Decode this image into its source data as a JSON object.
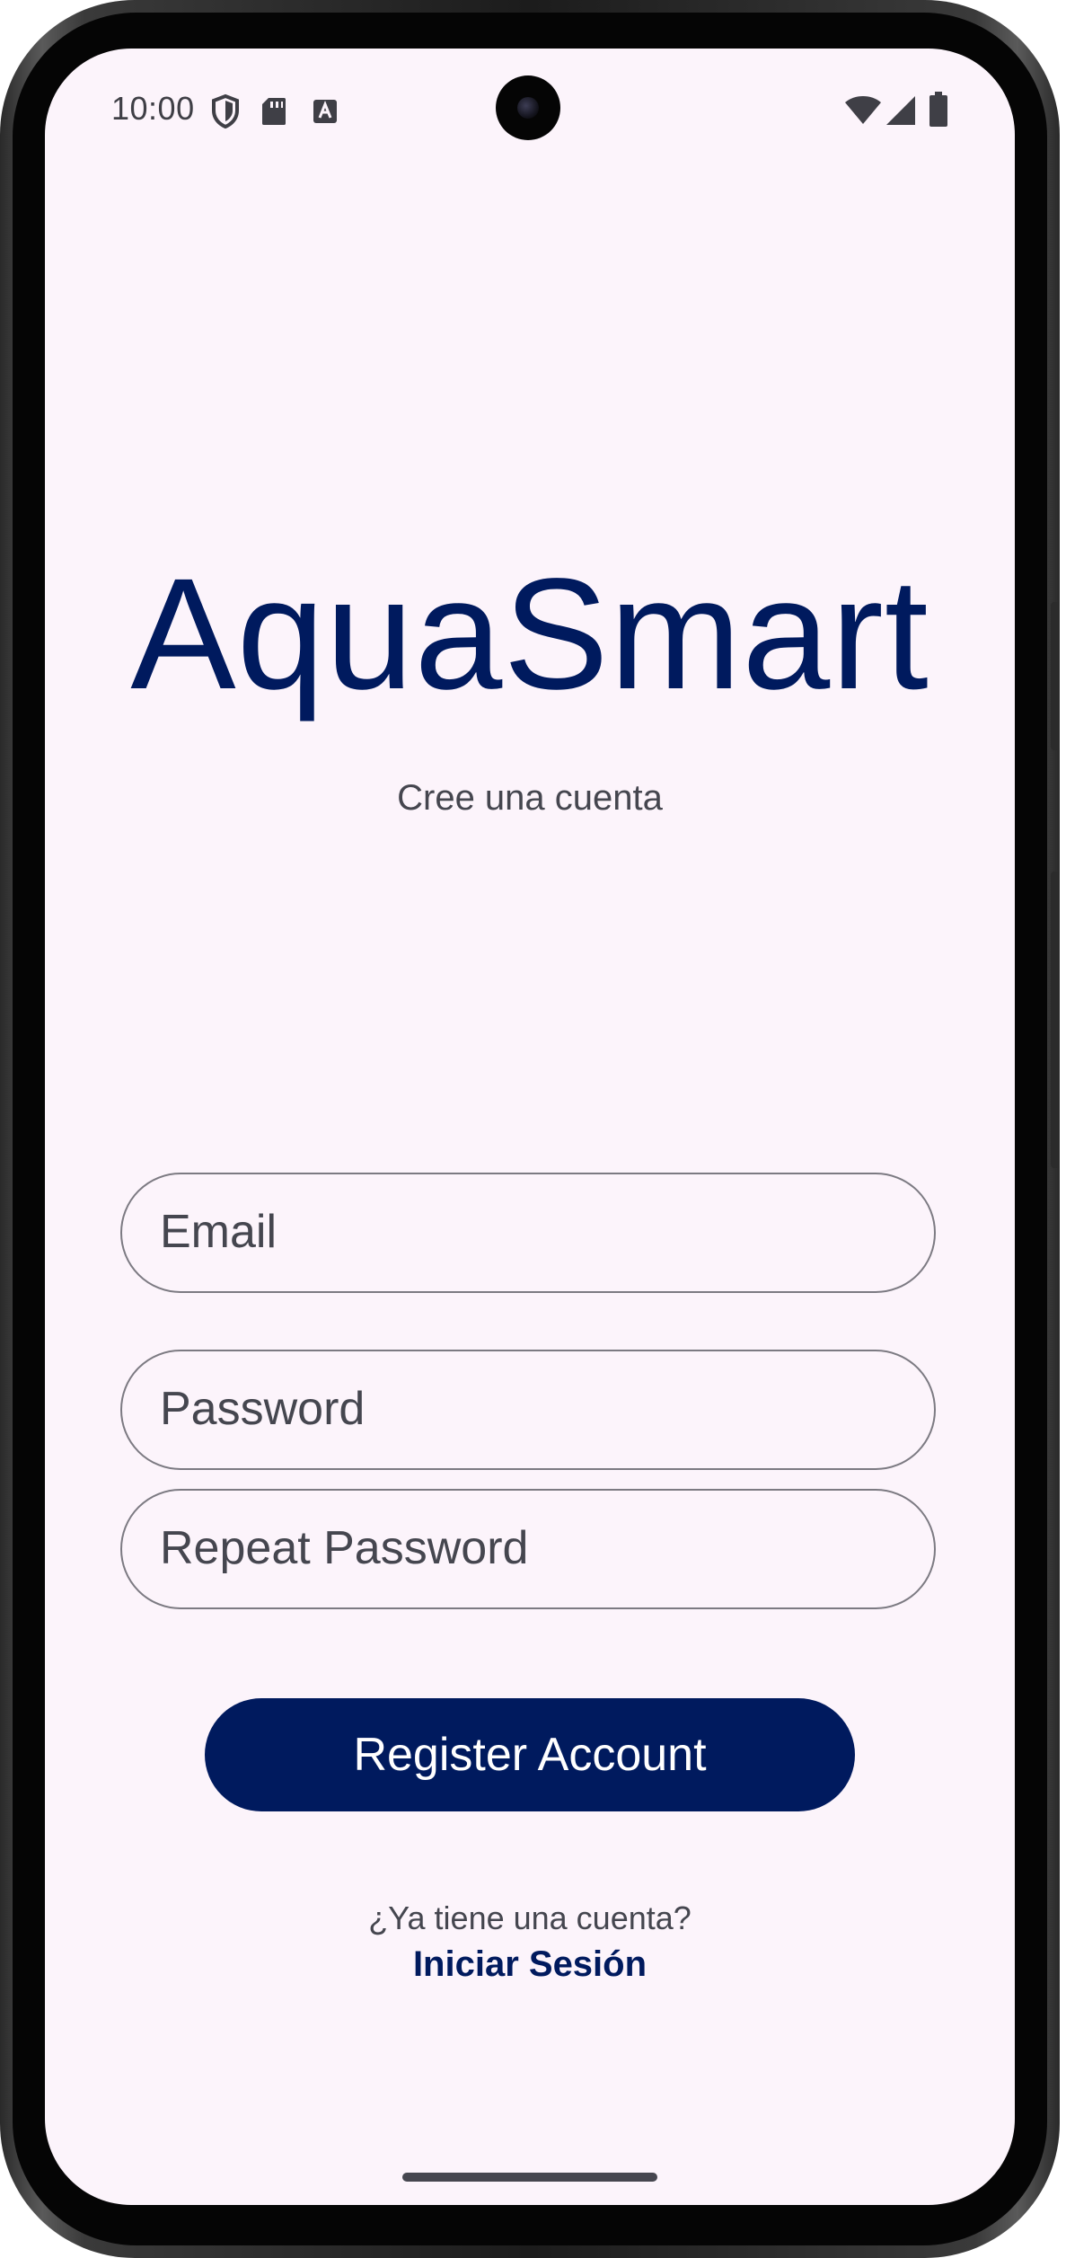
{
  "status_bar": {
    "time": "10:00",
    "left_icons": [
      "shield-icon",
      "sd-card-icon",
      "keyboard-a-icon"
    ],
    "right_icons": [
      "wifi-icon",
      "cellular-signal-icon",
      "battery-icon"
    ]
  },
  "app": {
    "title": "AquaSmart",
    "subtitle": "Cree una cuenta"
  },
  "form": {
    "email_label": "Email",
    "password_label": "Password",
    "repeat_password_label": "Repeat Password",
    "register_button_label": "Register Account"
  },
  "footer": {
    "question": "¿Ya tiene una cuenta?",
    "login_link": "Iniciar Sesión"
  },
  "colors": {
    "primary": "#001a5e",
    "background": "#fcf4fb",
    "outline": "#7c7a82",
    "text_secondary": "#45464f"
  }
}
